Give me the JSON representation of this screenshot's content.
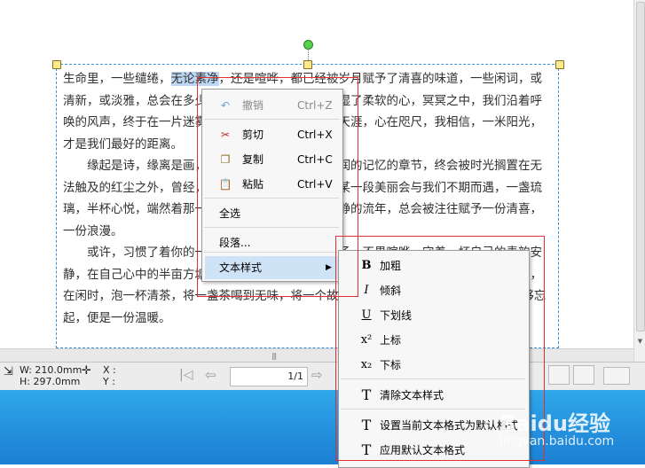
{
  "document": {
    "paragraphs": [
      {
        "indent": false,
        "segments": [
          {
            "text": "生命里，一些缱绻，"
          },
          {
            "text": "无论素净",
            "highlight": true
          },
          {
            "text": "，还是喧哗，都已经被岁月赋予了清喜的味道，一些闲词，或清新，或淡雅，总会在多少个辗转而去的日子里，濡湿了柔软的心，冥冥之中，我们沿着呼唤的风声，终于在一片迷雾中寻到了回归的岸，念在天涯，心在咫尺，我相信，一米阳光，才是我们最好的距离。"
          }
        ]
      },
      {
        "indent": true,
        "segments": [
          {
            "text": "缘起是诗，缘离是画，那些曾经被岁月打磨得圆润的记忆的章节，终会被时光搁置在无法触及的红尘之外，曾经，你一定会在某个时刻，与某一段美丽会与我们不期而遇，一盏琉璃，半杯心悦，端然着那一份淡然，在流年，在那些静的流年，总会被注往赋予一份清喜，一份浪漫。"
          }
        ]
      },
      {
        "indent": true,
        "segments": [
          {
            "text": "或许，习惯了着你的一份温柔，不张扬，不事张扬，不畏喧哗，守着一杯自己的素韵安静，在自己心中的半亩方塘里，轻轻点染生命的墨香，依附在心灵的每一个角落，也喜欢，在闲时，泡一杯清茶，将一盏茶喝到无味，将一个故事看到流泪.……心染尘，一只要能够忘起，便是一份温暖。"
          }
        ]
      }
    ]
  },
  "context_menu": {
    "items": [
      {
        "label": "撤销",
        "shortcut": "Ctrl+Z",
        "icon": "undo-icon",
        "disabled": true
      },
      {
        "label": "剪切",
        "shortcut": "Ctrl+X",
        "icon": "scissors-icon",
        "disabled": false
      },
      {
        "label": "复制",
        "shortcut": "Ctrl+C",
        "icon": "copy-icon",
        "disabled": false
      },
      {
        "label": "粘贴",
        "shortcut": "Ctrl+V",
        "icon": "paste-icon",
        "disabled": false
      },
      {
        "label": "全选",
        "shortcut": "",
        "icon": "",
        "disabled": false
      },
      {
        "label": "段落...",
        "shortcut": "",
        "icon": "",
        "disabled": false
      },
      {
        "label": "文本样式",
        "shortcut": "",
        "icon": "",
        "disabled": false,
        "submenu": true
      }
    ]
  },
  "submenu": {
    "items": [
      {
        "label": "加粗",
        "icon": "bold-icon",
        "glyph": "B"
      },
      {
        "label": "倾斜",
        "icon": "italic-icon",
        "glyph": "I"
      },
      {
        "label": "下划线",
        "icon": "underline-icon",
        "glyph": "U"
      },
      {
        "label": "上标",
        "icon": "superscript-icon",
        "glyph": "x²"
      },
      {
        "label": "下标",
        "icon": "subscript-icon",
        "glyph": "x₂"
      },
      {
        "label": "清除文本样式",
        "icon": "clear-style-icon",
        "glyph": "T"
      },
      {
        "label": "设置当前文本格式为默认格式",
        "icon": "set-default-style-icon",
        "glyph": "T"
      },
      {
        "label": "应用默认文本格式",
        "icon": "apply-default-style-icon",
        "glyph": "T"
      }
    ]
  },
  "statusbar": {
    "width_label": "W: 210.0mm",
    "height_label": "H: 297.0mm",
    "x_label": "X :",
    "y_label": "Y :",
    "page_value": "1/1"
  },
  "watermark": {
    "brand": "Baidu经验",
    "url": "jingyan.baidu.com"
  },
  "colors": {
    "selection": "#bcd7f3",
    "highlight_box": "#e03030",
    "taskbar": "#2196e0"
  }
}
